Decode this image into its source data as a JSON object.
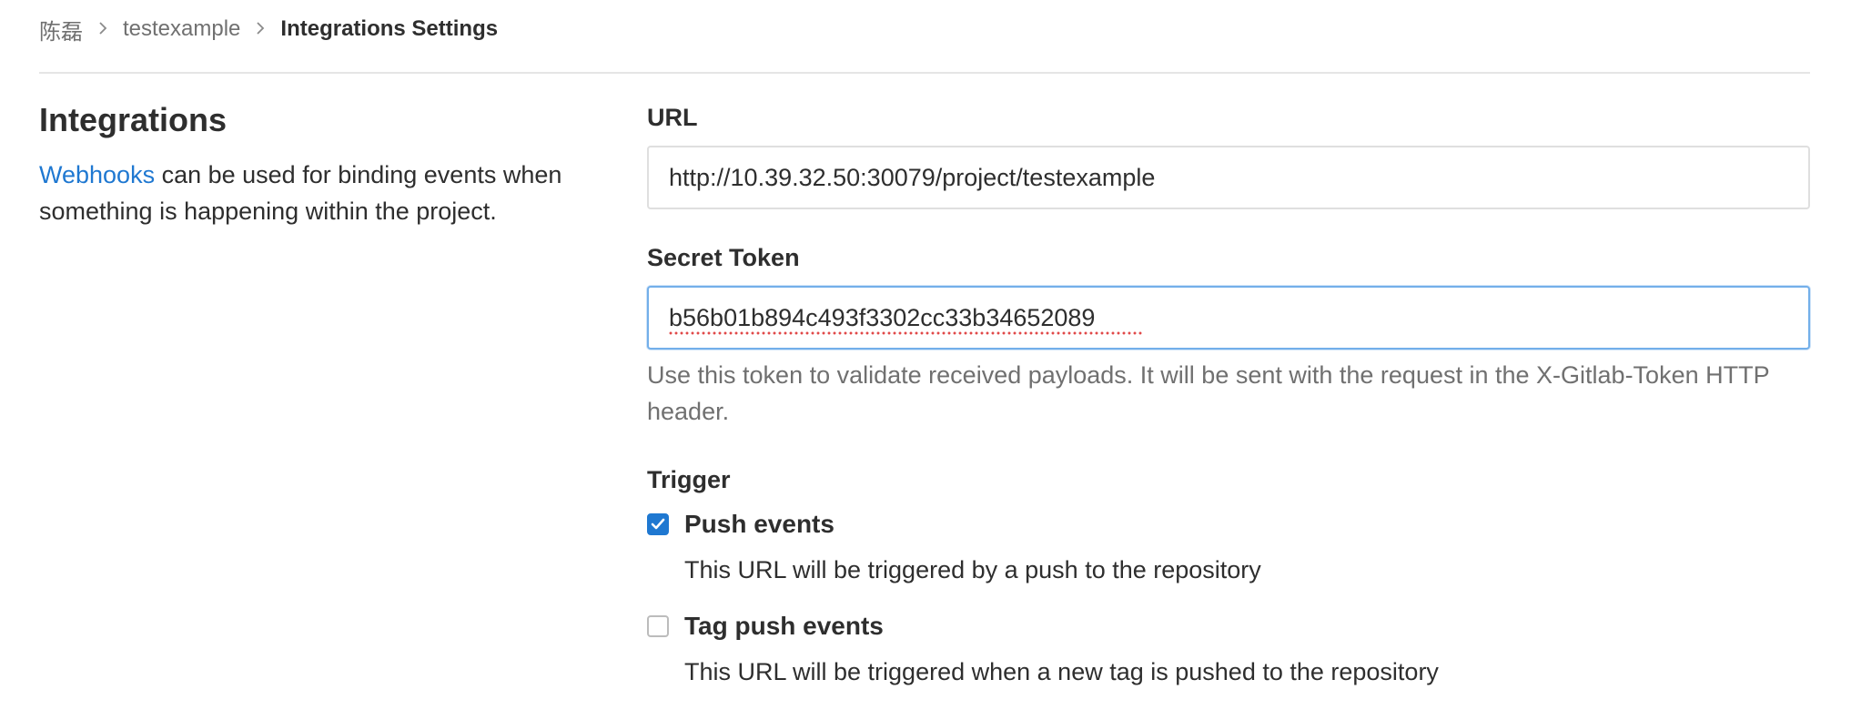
{
  "breadcrumb": {
    "items": [
      "陈磊",
      "testexample"
    ],
    "current": "Integrations Settings"
  },
  "intro": {
    "title": "Integrations",
    "link_text": "Webhooks",
    "desc_rest": " can be used for binding events when something is happening within the project."
  },
  "form": {
    "url_label": "URL",
    "url_value": "http://10.39.32.50:30079/project/testexample",
    "token_label": "Secret Token",
    "token_value": "b56b01b894c493f3302cc33b34652089",
    "token_help": "Use this token to validate received payloads. It will be sent with the request in the X-Gitlab-Token HTTP header."
  },
  "trigger": {
    "title": "Trigger",
    "items": [
      {
        "label": "Push events",
        "help": "This URL will be triggered by a push to the repository",
        "checked": true
      },
      {
        "label": "Tag push events",
        "help": "This URL will be triggered when a new tag is pushed to the repository",
        "checked": false
      }
    ]
  },
  "colors": {
    "link": "#1f78d1",
    "checkbox_checked": "#1f78d1",
    "focus_border": "#73afea",
    "muted_text": "#707070"
  },
  "icons": {
    "breadcrumb_separator": "chevron-right-icon",
    "checkmark": "check-icon"
  }
}
